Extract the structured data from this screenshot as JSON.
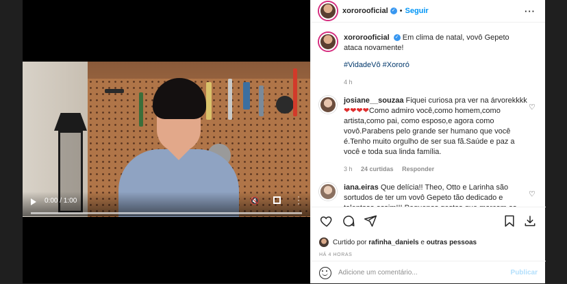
{
  "video": {
    "time": "0:00 / 1:00"
  },
  "post": {
    "username": "xororooficial",
    "follow_label": "Seguir",
    "caption_username": "xororooficial",
    "caption": "Em clima de natal, vovô Gepeto ataca novamente!",
    "hashtags": "#VidadeVô #Xororó",
    "caption_time": "4 h"
  },
  "comments": [
    {
      "username": "josiane__souzaa",
      "text_before": "Fiquei curiosa pra ver na árvorekkkk",
      "hearts": "❤❤❤❤",
      "text_after": "Como admiro você,como homem,como artista,como pai, como esposo,e agora como vovô.Parabens pelo grande ser humano que você é.Tenho muito orgulho de ser sua fã.Saúde e paz a você e toda sua linda família.",
      "time": "3 h",
      "likes": "24 curtidas",
      "reply": "Responder"
    },
    {
      "username": "iana.eiras",
      "text": "Que delícia!! Theo, Otto e Larinha são sortudos de ter um vovô Gepeto tão dedicado e talentoso assim!!! Pequenos gestos que marcam as crianças profundamente!! Parabéns família linda!!"
    }
  ],
  "actions": {
    "liked_prefix": "Curtido por",
    "liked_user": "rafinha_daniels",
    "liked_mid": "e",
    "liked_others": "outras pessoas",
    "timeago": "HÁ 4 HORAS"
  },
  "comment_box": {
    "placeholder": "Adicione um comentário...",
    "publish_label": "Publicar"
  },
  "colors": {
    "link_blue": "#0095f6",
    "hashtag": "#00376b",
    "muted": "#8e8e8e"
  }
}
